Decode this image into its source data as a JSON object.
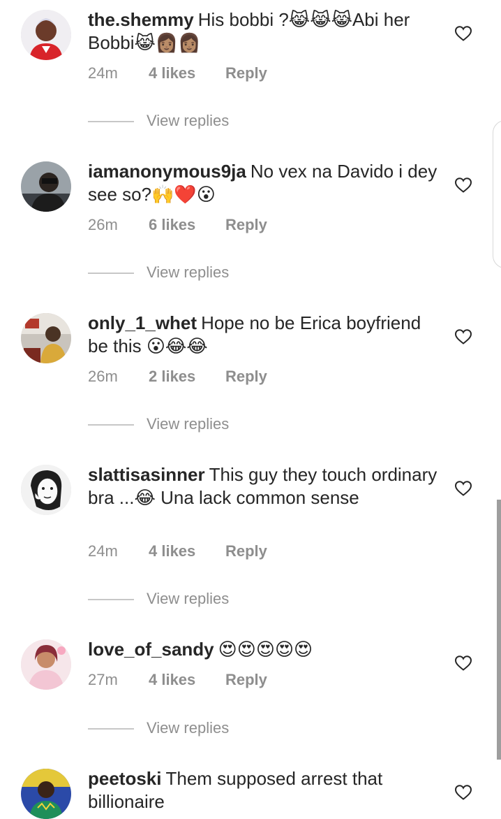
{
  "colors": {
    "text": "#262626",
    "muted": "#8e8e8e",
    "divider": "#c7c7c7",
    "background": "#ffffff"
  },
  "icons": {
    "like": "heart-outline-icon"
  },
  "comments": [
    {
      "username": "the.shemmy",
      "text": "His bobbi ?😹😹😹Abi her Bobbi😹👩🏽👩🏽",
      "time": "24m",
      "likes": "4 likes",
      "reply": "Reply",
      "view_replies": "View replies"
    },
    {
      "username": "iamanonymous9ja",
      "text": "No vex na Davido i dey see so?🙌❤️😮",
      "time": "26m",
      "likes": "6 likes",
      "reply": "Reply",
      "view_replies": "View replies"
    },
    {
      "username": "only_1_whet",
      "text": "Hope no be Erica boyfriend be this 😮😂😂",
      "time": "26m",
      "likes": "2 likes",
      "reply": "Reply",
      "view_replies": "View replies"
    },
    {
      "username": "slattisasinner",
      "text": "This guy they touch ordinary bra ...😂 Una lack common sense",
      "time": "24m",
      "likes": "4 likes",
      "reply": "Reply",
      "view_replies": "View replies"
    },
    {
      "username": "love_of_sandy",
      "text": "😍😍😍😍😍",
      "time": "27m",
      "likes": "4 likes",
      "reply": "Reply",
      "view_replies": "View replies"
    },
    {
      "username": "peetoski",
      "text": "Them supposed arrest that billionaire"
    }
  ]
}
